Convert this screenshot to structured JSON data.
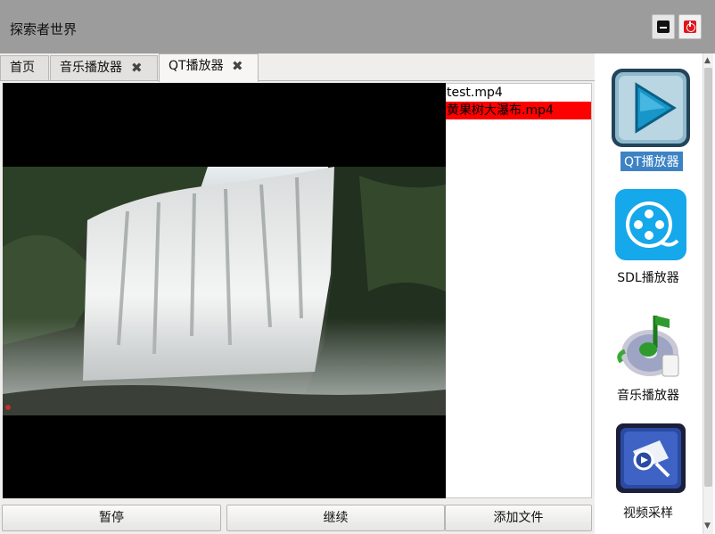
{
  "window": {
    "title": "探索者世界"
  },
  "tabs": [
    {
      "label": "首页",
      "closable": false,
      "active": false
    },
    {
      "label": "音乐播放器",
      "closable": true,
      "active": false
    },
    {
      "label": "QT播放器",
      "closable": true,
      "active": true
    }
  ],
  "tab_close_glyph": "✖",
  "playlist": {
    "items": [
      {
        "name": "test.mp4",
        "selected": false
      },
      {
        "name": "黄果树大瀑布.mp4",
        "selected": true
      }
    ]
  },
  "controls": {
    "pause_label": "暂停",
    "resume_label": "继续",
    "add_file_label": "添加文件"
  },
  "sidebar": {
    "items": [
      {
        "label": "QT播放器",
        "icon": "play-triangle-icon",
        "selected": true
      },
      {
        "label": "SDL播放器",
        "icon": "film-reel-icon",
        "selected": false
      },
      {
        "label": "音乐播放器",
        "icon": "music-note-cd-icon",
        "selected": false
      },
      {
        "label": "视频采样",
        "icon": "video-sampling-icon",
        "selected": false
      }
    ]
  },
  "colors": {
    "selected_row": "#ff0000",
    "sidebar_highlight": "#3d83c4",
    "title_bar": "#9d9c9d"
  }
}
